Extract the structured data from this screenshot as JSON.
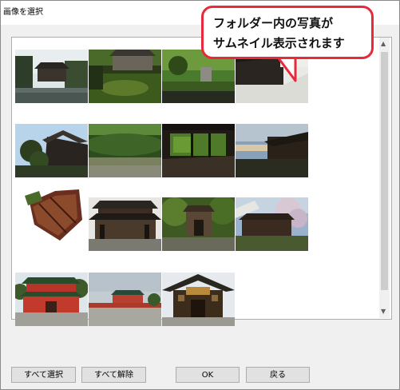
{
  "dialog": {
    "title": "画像を選択"
  },
  "callout": {
    "line1": "フォルダー内の写真が",
    "line2": "サムネイル表示されます"
  },
  "thumbnails": [
    {
      "name": "garden-pavilion-pond"
    },
    {
      "name": "moss-garden-temple"
    },
    {
      "name": "garden-stone-lantern"
    },
    {
      "name": "temple-veranda-gravel"
    },
    {
      "name": "pine-temple-roof"
    },
    {
      "name": "green-hill-garden"
    },
    {
      "name": "dark-corridor-garden"
    },
    {
      "name": "hillside-temple-dusk"
    },
    {
      "name": "tilted-temple-roof"
    },
    {
      "name": "temple-gate-front"
    },
    {
      "name": "forest-wooden-gate"
    },
    {
      "name": "cherry-blossom-hall"
    },
    {
      "name": "red-shrine-gate"
    },
    {
      "name": "shrine-courtyard"
    },
    {
      "name": "ornate-shrine-gate"
    }
  ],
  "buttons": {
    "select_all": "すべて選択",
    "deselect_all": "すべて解除",
    "ok": "OK",
    "back": "戻る"
  },
  "scrollbar": {
    "up_icon": "▲",
    "down_icon": "▼"
  },
  "colors": {
    "callout_border": "#e8293c",
    "button_bg": "#e1e1e1",
    "dialog_bg": "#f0f0f0"
  }
}
